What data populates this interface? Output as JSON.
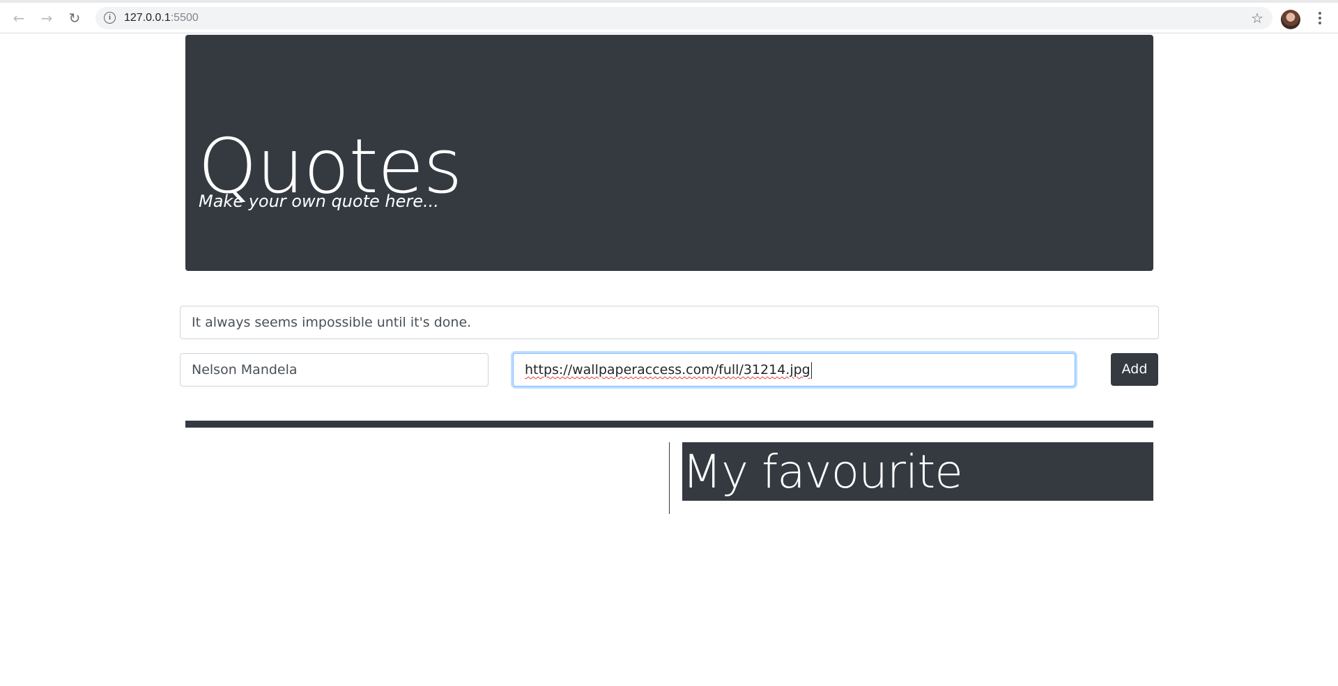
{
  "browser": {
    "url_host": "127.0.0.1",
    "url_port": ":5500"
  },
  "icons": {
    "back": "arrow-back-icon",
    "forward": "arrow-forward-icon",
    "reload": "reload-icon",
    "info": "info-icon",
    "bookmark": "star-icon",
    "profile": "avatar",
    "menu": "kebab-menu-icon"
  },
  "header": {
    "title": "Quotes",
    "subtitle": "Make your own quote here..."
  },
  "form": {
    "quote_value": "It always seems impossible until it's done.",
    "author_value": "Nelson Mandela",
    "image_url_value": "https://wallpaperaccess.com/full/31214.jpg",
    "add_label": "Add"
  },
  "favourites": {
    "heading": "My favourite"
  },
  "colors": {
    "dark": "#343a40",
    "focus_border": "#80bdff",
    "omnibox_bg": "#f1f3f4"
  }
}
